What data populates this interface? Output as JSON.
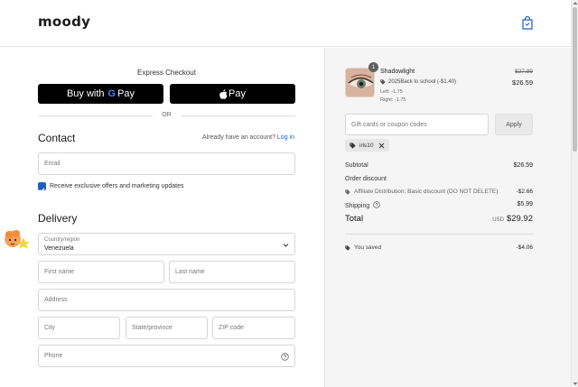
{
  "header": {
    "logo": "moody"
  },
  "express": {
    "title": "Express Checkout",
    "gpay_prefix": "Buy with",
    "gpay_brand_g": "G",
    "gpay_brand_pay": "Pay",
    "apple_pay": "Pay",
    "or": "OR"
  },
  "contact": {
    "heading": "Contact",
    "account_prompt": "Already have an account?",
    "login_link": "Log in",
    "email_placeholder": "Email",
    "offers_label": "Receive exclusive offers and marketing updates"
  },
  "delivery": {
    "heading": "Delivery",
    "country_caption": "Country/region",
    "country_value": "Venezuela",
    "first_name": "First name",
    "last_name": "Last name",
    "address": "Address",
    "city": "City",
    "state": "State/province",
    "zip": "ZIP code",
    "phone": "Phone"
  },
  "summary": {
    "product": {
      "quantity": "1",
      "name": "Shadowlight",
      "discount_label": "2025Back to school (-$1.40)",
      "left": "Left: -1.75",
      "right": "Right: -1.75",
      "original_price": "$27.99",
      "price": "$26.59"
    },
    "coupon_placeholder": "Gift cards or coupon codes",
    "apply_label": "Apply",
    "applied_code": "iris10",
    "subtotal_label": "Subtotal",
    "subtotal_value": "$26.59",
    "order_discount_label": "Order discount",
    "affiliate_label": "Affiliate Distribution: Basic discount (DO NOT DELETE)",
    "affiliate_value": "-$2.66",
    "shipping_label": "Shipping",
    "shipping_value": "$5.99",
    "total_label": "Total",
    "total_currency": "USD",
    "total_value": "$29.92",
    "saved_label": "You saved",
    "saved_value": "-$4.06"
  },
  "colors": {
    "accent": "#1f5fbf",
    "button": "#000000",
    "panel": "#f5f5f5"
  }
}
